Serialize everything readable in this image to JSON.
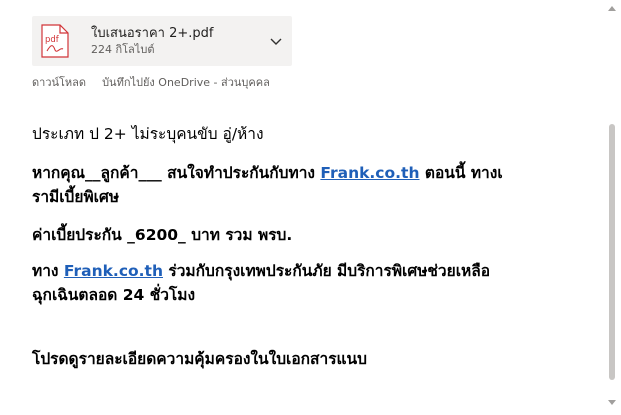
{
  "attachment": {
    "filename": "ใบเสนอราคา 2+.pdf",
    "size": "224 กิโลไบต์",
    "icon": "pdf-icon",
    "icon_label": "pdf",
    "accent_color": "#d13438",
    "actions": {
      "download": "ดาวน์โหลด",
      "save_to_onedrive": "บันทึกไปยัง OneDrive - ส่วนบุคคล"
    }
  },
  "message": {
    "line1": "ประเภท ป 2+   ไม่ระบุคนขับ  อู่/ห้าง",
    "line2_pre": "หากคุณ__ลูกค้า___ สนใจทำประกันกับทาง ",
    "line2_link": "Frank.co.th",
    "line2_post": " ตอนนี้ ทางเ",
    "line3": "รามีเบี้ยพิเศษ",
    "line4": " ค่าเบี้ยประกัน  _6200_ บาท  รวม พรบ.",
    "line5_pre": "  ทาง ",
    "line5_link": "Frank.co.th",
    "line5_post": " ร่วมกับกรุงเทพประกันภัย มีบริการพิเศษช่วยเหลือ",
    "line6": "ฉุกเฉินตลอด 24 ชั่วโมง",
    "line7": "โปรดดูรายละเอียดความคุ้มครองในใบเอกสารแนบ"
  }
}
